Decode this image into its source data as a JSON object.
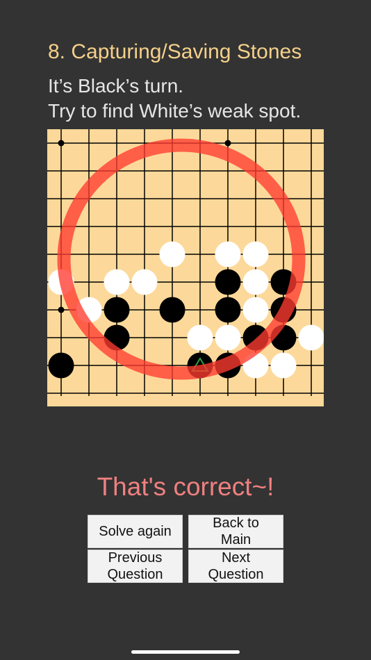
{
  "header": {
    "title": "8. Capturing/Saving Stones",
    "instruction_line1": "It’s Black’s turn.",
    "instruction_line2": "Try to find White’s weak spot."
  },
  "board": {
    "background_color": "#fcd99a",
    "line_color": "#000000",
    "visible_columns": 10,
    "visible_rows": 10,
    "star_points": [
      [
        0,
        0
      ],
      [
        6,
        0
      ],
      [
        0,
        6
      ]
    ],
    "white_stones": [
      [
        0,
        5
      ],
      [
        1,
        6
      ],
      [
        2,
        5
      ],
      [
        3,
        5
      ],
      [
        4,
        4
      ],
      [
        5,
        7
      ],
      [
        6,
        4
      ],
      [
        6,
        7
      ],
      [
        7,
        4
      ],
      [
        7,
        5
      ],
      [
        7,
        6
      ],
      [
        7,
        8
      ],
      [
        8,
        8
      ],
      [
        9,
        7
      ]
    ],
    "black_stones": [
      [
        0,
        8
      ],
      [
        2,
        6
      ],
      [
        2,
        7
      ],
      [
        4,
        6
      ],
      [
        6,
        5
      ],
      [
        6,
        6
      ],
      [
        6,
        8
      ],
      [
        7,
        7
      ],
      [
        8,
        5
      ],
      [
        8,
        6
      ],
      [
        8,
        7
      ]
    ],
    "last_move": [
      5,
      8
    ],
    "last_move_marker": "triangle",
    "last_move_marker_color": "#2ea043",
    "result_circle_color": "#ff3b30"
  },
  "feedback": {
    "text": "That's correct~!",
    "color": "#f08080"
  },
  "buttons": {
    "solve_again": "Solve again",
    "back_to_main": "Back to Main",
    "previous_question": "Previous Question",
    "next_question": "Next Question"
  }
}
